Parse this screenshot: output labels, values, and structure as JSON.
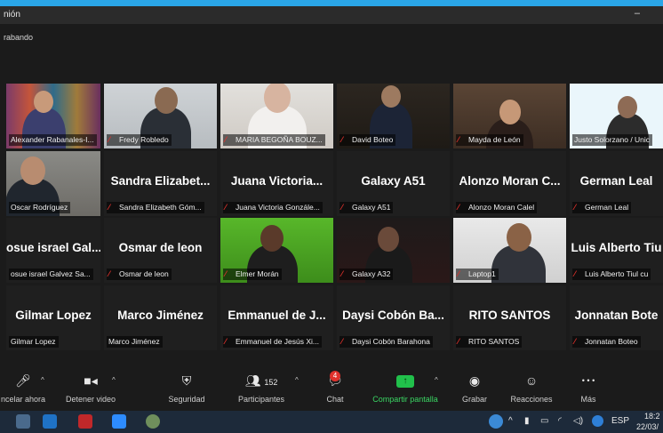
{
  "window": {
    "title": "nión",
    "minimize_glyph": "–",
    "recording_text": "rabando"
  },
  "tiles": [
    {
      "name": "Alexander Rabanales-I...",
      "muted": false,
      "type": "video",
      "scene": "colorful"
    },
    {
      "name": "Fredy Robledo",
      "muted": true,
      "type": "video",
      "scene": "office"
    },
    {
      "name": "MARIA BEGOÑA BOUZ...",
      "muted": true,
      "type": "video",
      "scene": "home"
    },
    {
      "name": "David Boteo",
      "muted": true,
      "type": "video",
      "scene": "dark"
    },
    {
      "name": "Mayda de León",
      "muted": true,
      "type": "video",
      "scene": "warm"
    },
    {
      "name": "Justo Solorzano / Unic",
      "muted": false,
      "type": "video",
      "scene": "unicef",
      "active": true
    },
    {
      "name": "Oscar Rodríguez",
      "muted": false,
      "type": "video",
      "scene": "room"
    },
    {
      "display": "Sandra  Elizabet...",
      "name": "Sandra Elizabeth Góm...",
      "muted": true,
      "type": "name"
    },
    {
      "display": "Juana  Victoria...",
      "name": "Juana Victoria Gonzále...",
      "muted": true,
      "type": "name"
    },
    {
      "display": "Galaxy A51",
      "name": "Galaxy A51",
      "muted": true,
      "type": "name"
    },
    {
      "display": "Alonzo Moran C...",
      "name": "Alonzo Moran Calel",
      "muted": true,
      "type": "name"
    },
    {
      "display": "German Leal",
      "name": "German Leal",
      "muted": true,
      "type": "name"
    },
    {
      "display": "osue israel Gal...",
      "name": "osue israel Galvez Sa...",
      "muted": false,
      "type": "name"
    },
    {
      "display": "Osmar de leon",
      "name": "Osmar de leon",
      "muted": true,
      "type": "name"
    },
    {
      "name": "Elmer Morán",
      "muted": true,
      "type": "video",
      "scene": "green"
    },
    {
      "name": "Galaxy A32",
      "muted": true,
      "type": "video",
      "scene": "darkphone"
    },
    {
      "name": "Laptop1",
      "muted": true,
      "type": "video",
      "scene": "laptop"
    },
    {
      "display": "Luis Alberto Tiu",
      "name": "Luis Alberto Tiul cu",
      "muted": true,
      "type": "name"
    },
    {
      "display": "Gilmar  Lopez",
      "name": "Gilmar Lopez",
      "muted": false,
      "type": "name"
    },
    {
      "display": "Marco Jiménez",
      "name": "Marco Jiménez",
      "muted": false,
      "type": "name"
    },
    {
      "display": "Emmanuel de J...",
      "name": "Emmanuel de Jesús Xi...",
      "muted": true,
      "type": "name"
    },
    {
      "display": "Daysi Cobón Ba...",
      "name": "Daysi Cobón Barahona",
      "muted": true,
      "type": "name"
    },
    {
      "display": "RITO SANTOS",
      "name": "RITO SANTOS",
      "muted": true,
      "type": "name"
    },
    {
      "display": "Jonnatan Bote",
      "name": "Jonnatan Boteo",
      "muted": true,
      "type": "name"
    }
  ],
  "toolbar": {
    "mute": "ncelar ahora",
    "video": "Detener video",
    "security": "Seguridad",
    "participants": "Participantes",
    "participants_count": "152",
    "chat": "Chat",
    "chat_badge": "4",
    "share": "Compartir pantalla",
    "record": "Grabar",
    "reactions": "Reacciones",
    "more": "Más",
    "more_glyph": "• • •"
  },
  "taskbar": {
    "lang": "ESP",
    "time": "18:2",
    "date": "22/03/"
  },
  "colors": {
    "accent": "#2aa6e8",
    "share_green": "#21c04b",
    "muted_red": "#e0312c",
    "active_outline": "#b9d84a"
  }
}
